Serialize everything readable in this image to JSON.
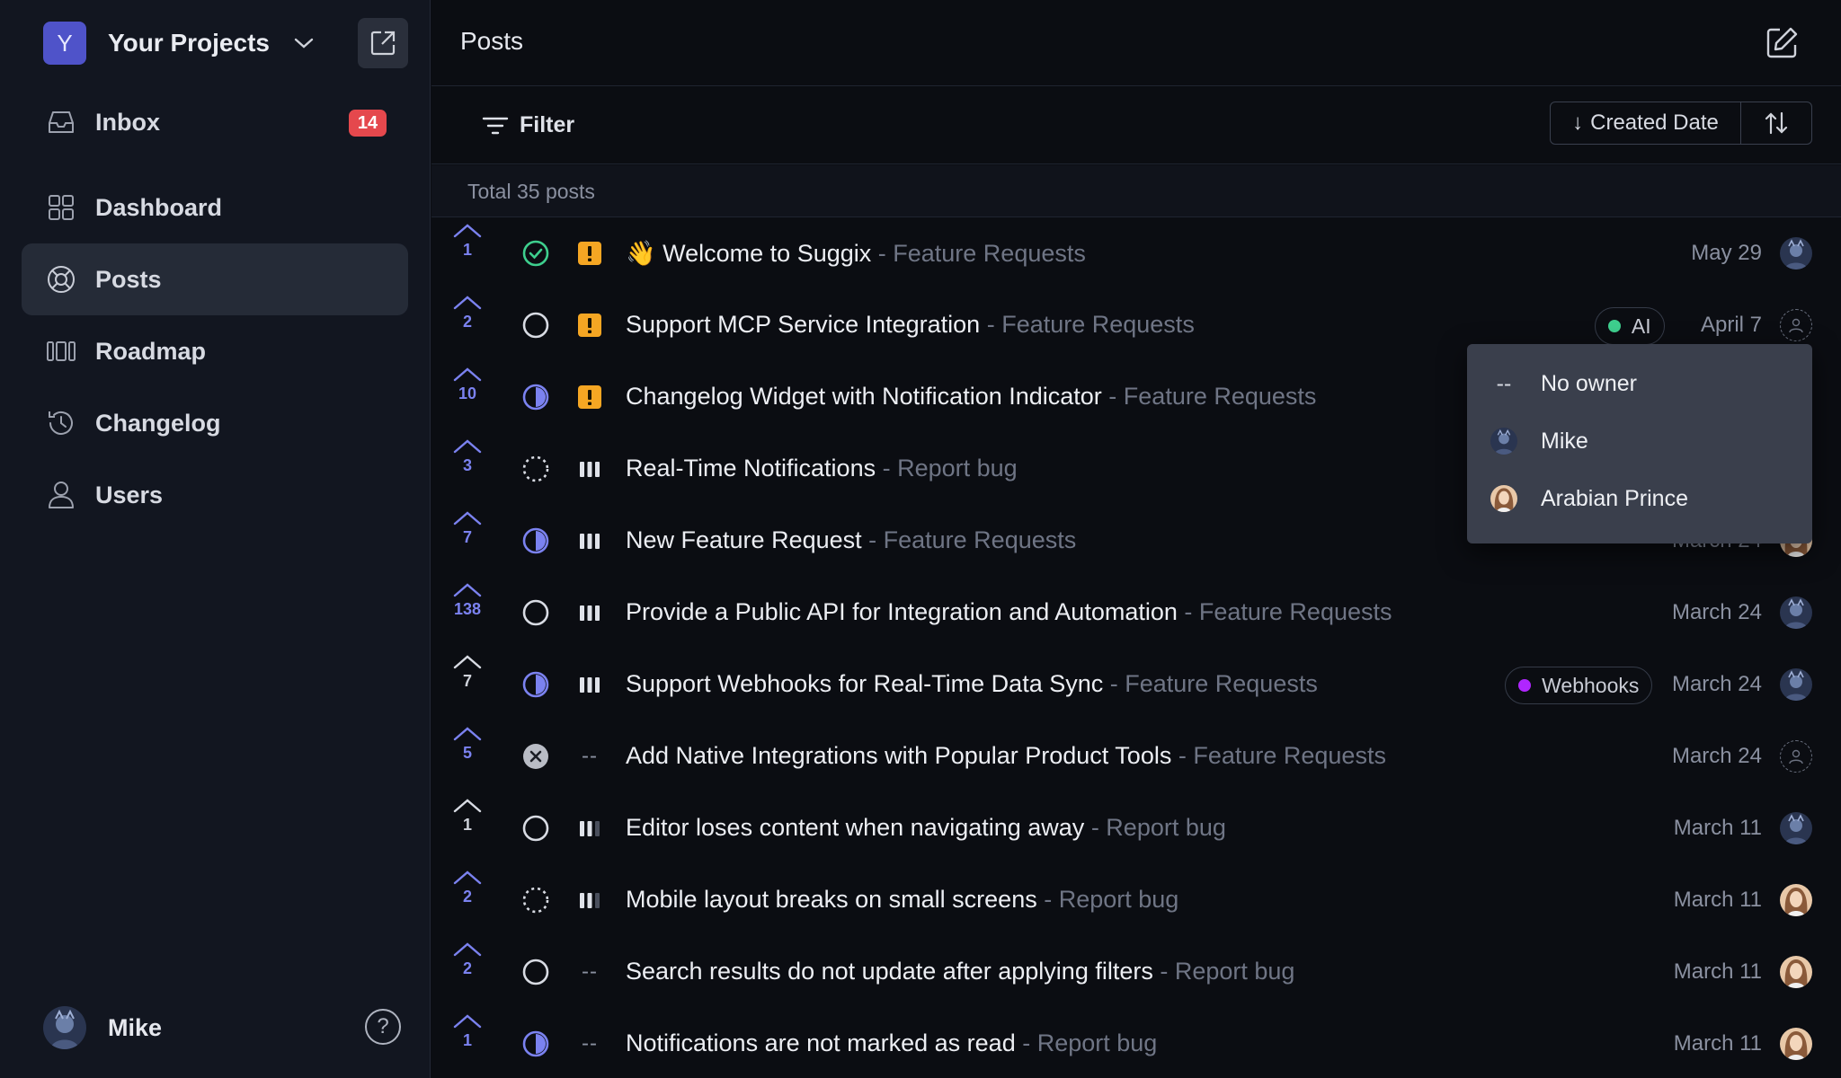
{
  "sidebar": {
    "project_initial": "Y",
    "project_name": "Your Projects",
    "nav": [
      {
        "label": "Inbox",
        "icon": "inbox-icon",
        "badge": "14"
      },
      {
        "label": "Dashboard",
        "icon": "dashboard-icon"
      },
      {
        "label": "Posts",
        "icon": "posts-icon",
        "active": true
      },
      {
        "label": "Roadmap",
        "icon": "roadmap-icon"
      },
      {
        "label": "Changelog",
        "icon": "changelog-icon"
      },
      {
        "label": "Users",
        "icon": "users-icon"
      }
    ],
    "user_name": "Mike",
    "help_glyph": "?"
  },
  "header": {
    "title": "Posts"
  },
  "toolbar": {
    "filter_label": "Filter",
    "sort_field": "Created Date",
    "sort_arrow": "↓"
  },
  "list": {
    "total": "Total 35 posts",
    "posts": [
      {
        "votes": "1",
        "status": "done",
        "priority": "urgent",
        "emoji": "👋",
        "title": "Welcome to Suggix",
        "board": " - Feature Requests",
        "date": "May 29",
        "owner": "mike"
      },
      {
        "votes": "2",
        "status": "open",
        "priority": "urgent",
        "title": "Support MCP Service Integration",
        "board": " - Feature Requests",
        "tag": "AI",
        "tag_color": "#3ecf8e",
        "date": "April 7",
        "owner": "none"
      },
      {
        "votes": "10",
        "status": "half",
        "priority": "urgent",
        "title": "Changelog Widget with Notification Indicator",
        "board": " - Feature Requests",
        "date": "",
        "owner": "hidden"
      },
      {
        "votes": "3",
        "status": "planned",
        "priority": "high",
        "title": "Real-Time Notifications",
        "board": " - Report bug",
        "date": "",
        "owner": "hidden"
      },
      {
        "votes": "7",
        "status": "half",
        "priority": "high",
        "title": "New Feature Request",
        "board": " - Feature Requests",
        "date": "March 24",
        "owner": "arabian"
      },
      {
        "votes": "138",
        "status": "open",
        "priority": "high",
        "title": "Provide a Public API for Integration and Automation",
        "board": " - Feature Requests",
        "date": "March 24",
        "owner": "mike"
      },
      {
        "votes": "7",
        "status": "half",
        "priority": "high",
        "title": "Support Webhooks for Real-Time Data Sync",
        "board": " - Feature Requests",
        "tag": "Webhooks",
        "tag_color": "#b026ff",
        "date": "March 24",
        "owner": "mike",
        "neutral": true
      },
      {
        "votes": "5",
        "status": "closed",
        "priority": "none",
        "title": "Add Native Integrations with Popular Product Tools",
        "board": " - Feature Requests",
        "date": "March 24",
        "owner": "none"
      },
      {
        "votes": "1",
        "status": "open",
        "priority": "medium",
        "title": "Editor loses content when navigating away",
        "board": " - Report bug",
        "date": "March 11",
        "owner": "mike",
        "neutral": true
      },
      {
        "votes": "2",
        "status": "planned",
        "priority": "medium",
        "title": "Mobile layout breaks on small screens",
        "board": " - Report bug",
        "date": "March 11",
        "owner": "arabian"
      },
      {
        "votes": "2",
        "status": "open",
        "priority": "none",
        "title": "Search results do not update after applying filters",
        "board": " - Report bug",
        "date": "March 11",
        "owner": "arabian"
      },
      {
        "votes": "1",
        "status": "half",
        "priority": "none",
        "title": "Notifications are not marked as read",
        "board": " - Report bug",
        "date": "March 11",
        "owner": "arabian"
      }
    ]
  },
  "owner_menu": {
    "items": [
      {
        "label": "No owner",
        "icon": "--"
      },
      {
        "label": "Mike",
        "icon": "mike"
      },
      {
        "label": "Arabian Prince",
        "icon": "arabian"
      }
    ]
  },
  "colors": {
    "accent": "#4f53c9",
    "vote": "#7b82f0",
    "done": "#3ecf8e",
    "urgent": "#f5a623",
    "badge": "#e5484d"
  }
}
